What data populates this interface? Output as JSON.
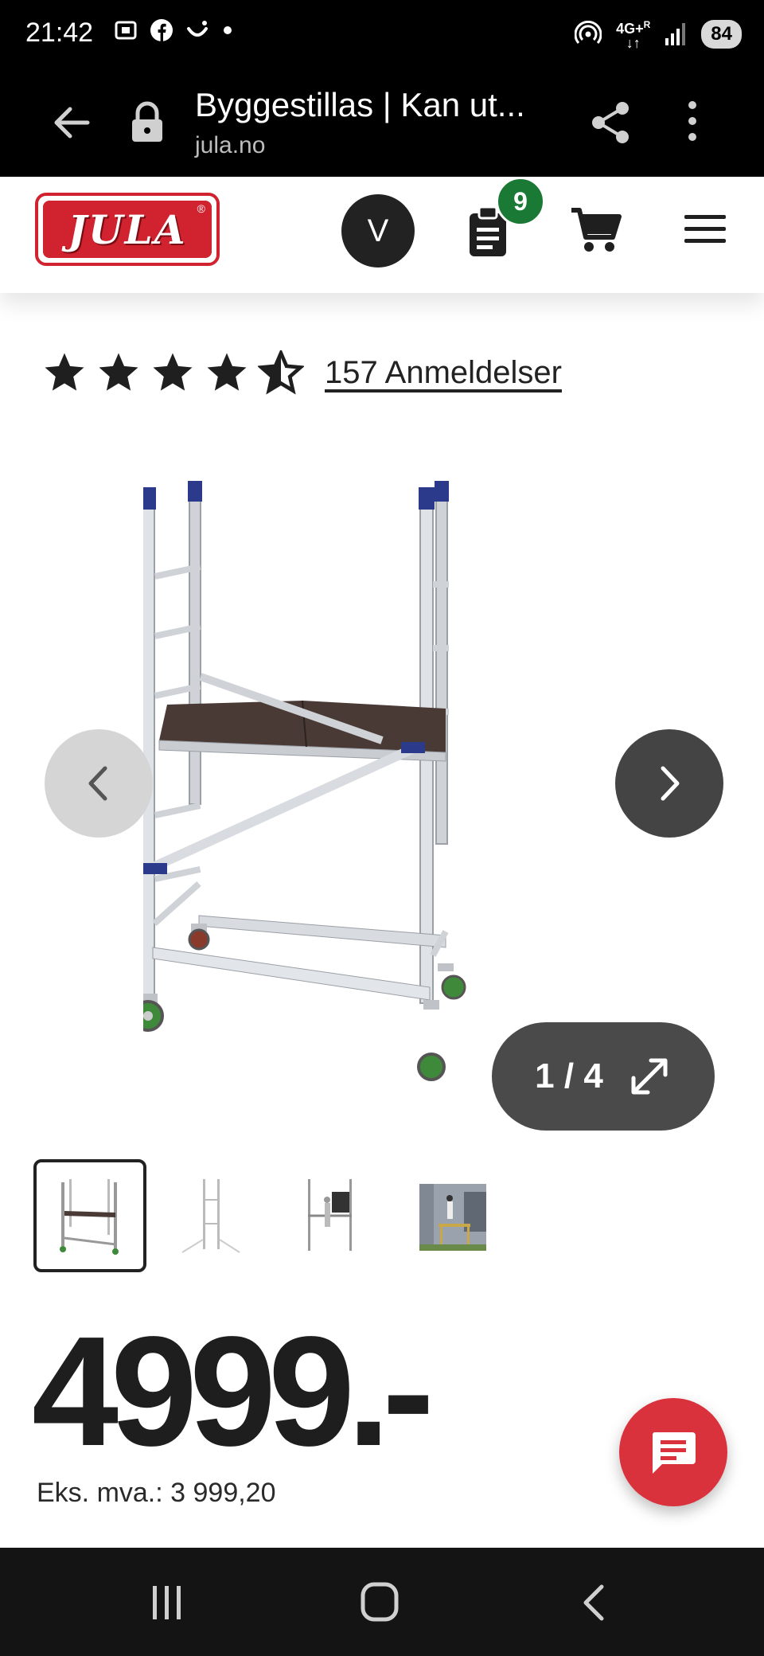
{
  "status_bar": {
    "time": "21:42",
    "network": "4G+",
    "network_sup": "R",
    "battery": "84"
  },
  "browser": {
    "page_title": "Byggestillas | Kan ut...",
    "domain": "jula.no"
  },
  "header": {
    "logo_text": "JULA",
    "logo_reg": "®",
    "avatar_initial": "V",
    "list_badge_count": "9"
  },
  "rating": {
    "stars": 4.5,
    "reviews_label": "157 Anmeldelser"
  },
  "gallery": {
    "current": "1",
    "separator": "/",
    "total": "4"
  },
  "price": {
    "amount": "4999.-",
    "ex_vat": "Eks. mva.: 3 999,20"
  },
  "colors": {
    "brand_red": "#d0232f",
    "badge_green": "#1a7a35",
    "chat_red": "#d9323d"
  }
}
